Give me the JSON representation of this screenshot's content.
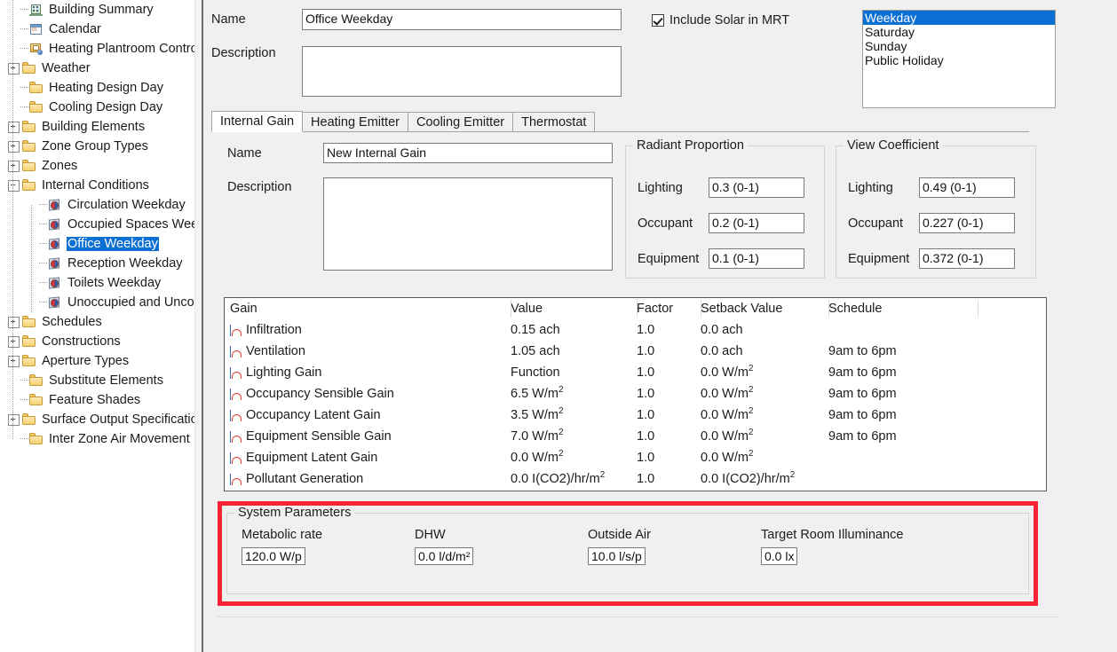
{
  "tree": {
    "items": [
      {
        "label": "Building Summary",
        "icon": "building-icon",
        "indent": 0,
        "toggle": "none",
        "selected": false
      },
      {
        "label": "Calendar",
        "icon": "calendar-icon",
        "indent": 0,
        "toggle": "none",
        "selected": false
      },
      {
        "label": "Heating Plantroom Control",
        "icon": "control-icon",
        "indent": 0,
        "toggle": "none",
        "selected": false
      },
      {
        "label": "Weather",
        "icon": "folder-icon",
        "indent": 0,
        "toggle": "plus",
        "selected": false
      },
      {
        "label": "Heating Design Day",
        "icon": "folder-icon",
        "indent": 0,
        "toggle": "none",
        "selected": false
      },
      {
        "label": "Cooling Design Day",
        "icon": "folder-icon",
        "indent": 0,
        "toggle": "none",
        "selected": false
      },
      {
        "label": "Building Elements",
        "icon": "folder-icon",
        "indent": 0,
        "toggle": "plus",
        "selected": false
      },
      {
        "label": "Zone Group Types",
        "icon": "folder-icon",
        "indent": 0,
        "toggle": "plus",
        "selected": false
      },
      {
        "label": "Zones",
        "icon": "folder-icon",
        "indent": 0,
        "toggle": "plus",
        "selected": false
      },
      {
        "label": "Internal Conditions",
        "icon": "folder-icon",
        "indent": 0,
        "toggle": "minus",
        "selected": false
      },
      {
        "label": "Circulation Weekday",
        "icon": "internal-condition-icon",
        "indent": 1,
        "toggle": "none",
        "selected": false
      },
      {
        "label": "Occupied Spaces Weekend",
        "icon": "internal-condition-icon",
        "indent": 1,
        "toggle": "none",
        "selected": false
      },
      {
        "label": "Office Weekday",
        "icon": "internal-condition-icon",
        "indent": 1,
        "toggle": "none",
        "selected": true
      },
      {
        "label": "Reception Weekday",
        "icon": "internal-condition-icon",
        "indent": 1,
        "toggle": "none",
        "selected": false
      },
      {
        "label": "Toilets Weekday",
        "icon": "internal-condition-icon",
        "indent": 1,
        "toggle": "none",
        "selected": false
      },
      {
        "label": "Unoccupied and Unconditioned",
        "icon": "internal-condition-icon",
        "indent": 1,
        "toggle": "none",
        "selected": false
      },
      {
        "label": "Schedules",
        "icon": "folder-icon",
        "indent": 0,
        "toggle": "plus",
        "selected": false
      },
      {
        "label": "Constructions",
        "icon": "folder-icon",
        "indent": 0,
        "toggle": "plus",
        "selected": false
      },
      {
        "label": "Aperture Types",
        "icon": "folder-icon",
        "indent": 0,
        "toggle": "plus",
        "selected": false
      },
      {
        "label": "Substitute Elements",
        "icon": "folder-icon",
        "indent": 0,
        "toggle": "none",
        "selected": false
      },
      {
        "label": "Feature Shades",
        "icon": "folder-icon",
        "indent": 0,
        "toggle": "none",
        "selected": false
      },
      {
        "label": "Surface Output Specifications",
        "icon": "folder-icon",
        "indent": 0,
        "toggle": "plus",
        "selected": false
      },
      {
        "label": "Inter Zone Air Movement",
        "icon": "folder-icon",
        "indent": 0,
        "toggle": "none",
        "selected": false
      }
    ]
  },
  "header": {
    "name_label": "Name",
    "name_value": "Office Weekday",
    "description_label": "Description",
    "description_value": "",
    "include_solar_label": "Include Solar in MRT",
    "include_solar_checked": true
  },
  "day_types": {
    "items": [
      "Weekday",
      "Saturday",
      "Sunday",
      "Public Holiday"
    ],
    "selected": "Weekday"
  },
  "tabs": {
    "items": [
      "Internal Gain",
      "Heating Emitter",
      "Cooling Emitter",
      "Thermostat"
    ],
    "active": "Internal Gain"
  },
  "internal_gain": {
    "name_label": "Name",
    "name_value": "New Internal Gain",
    "description_label": "Description",
    "description_value": "",
    "radiant_proportion": {
      "title": "Radiant Proportion",
      "rows": [
        {
          "label": "Lighting",
          "value": "0.3 (0-1)"
        },
        {
          "label": "Occupant",
          "value": "0.2 (0-1)"
        },
        {
          "label": "Equipment",
          "value": "0.1 (0-1)"
        }
      ]
    },
    "view_coefficient": {
      "title": "View Coefficient",
      "rows": [
        {
          "label": "Lighting",
          "value": "0.49 (0-1)"
        },
        {
          "label": "Occupant",
          "value": "0.227 (0-1)"
        },
        {
          "label": "Equipment",
          "value": "0.372 (0-1)"
        }
      ]
    }
  },
  "gains_table": {
    "columns": [
      "Gain",
      "Value",
      "Factor",
      "Setback Value",
      "Schedule"
    ],
    "rows": [
      {
        "gain": "Infiltration",
        "value": "0.15 ach",
        "factor": "1.0",
        "setback": "0.0 ach",
        "schedule": ""
      },
      {
        "gain": "Ventilation",
        "value": "1.05 ach",
        "factor": "1.0",
        "setback": "0.0 ach",
        "schedule": "9am to 6pm"
      },
      {
        "gain": "Lighting Gain",
        "value": "Function",
        "factor": "1.0",
        "setback": "0.0 W/m²",
        "schedule": "9am to 6pm"
      },
      {
        "gain": "Occupancy Sensible Gain",
        "value": "6.5 W/m²",
        "factor": "1.0",
        "setback": "0.0 W/m²",
        "schedule": "9am to 6pm"
      },
      {
        "gain": "Occupancy Latent Gain",
        "value": "3.5 W/m²",
        "factor": "1.0",
        "setback": "0.0 W/m²",
        "schedule": "9am to 6pm"
      },
      {
        "gain": "Equipment Sensible Gain",
        "value": "7.0 W/m²",
        "factor": "1.0",
        "setback": "0.0 W/m²",
        "schedule": "9am to 6pm"
      },
      {
        "gain": "Equipment Latent Gain",
        "value": "0.0 W/m²",
        "factor": "1.0",
        "setback": "0.0 W/m²",
        "schedule": ""
      },
      {
        "gain": "Pollutant Generation",
        "value": "0.0 I(CO2)/hr/m²",
        "factor": "1.0",
        "setback": "0.0 I(CO2)/hr/m²",
        "schedule": ""
      }
    ]
  },
  "system_parameters": {
    "title": "System Parameters",
    "highlight_color": "#f42434",
    "fields": [
      {
        "label": "Metabolic rate",
        "value": "120.0 W/p"
      },
      {
        "label": "DHW",
        "value": "0.0 l/d/m²"
      },
      {
        "label": "Outside Air",
        "value": "10.0 l/s/p"
      },
      {
        "label": "Target Room Illuminance",
        "value": "0.0 lx"
      }
    ]
  }
}
